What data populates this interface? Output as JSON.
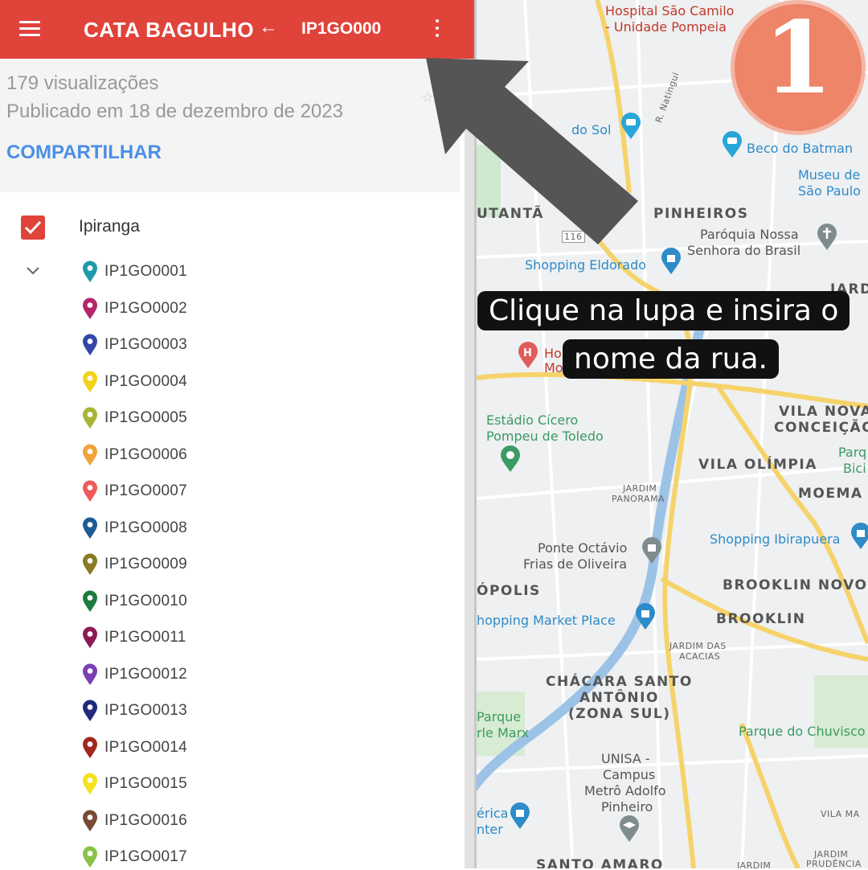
{
  "header": {
    "app_title": "CATA BAGULHO",
    "layer_title": "IP1GO000"
  },
  "info": {
    "views": "179 visualizações",
    "published": "Publicado em 18 de dezembro de 2023",
    "share_label": "COMPARTILHAR"
  },
  "layer": {
    "name": "Ipiranga",
    "checked": true,
    "items": [
      {
        "label": "IP1GO0001",
        "color": "#1f9aa8"
      },
      {
        "label": "IP1GO0002",
        "color": "#b3266b"
      },
      {
        "label": "IP1GO0003",
        "color": "#3547a8"
      },
      {
        "label": "IP1GO0004",
        "color": "#f2d21c"
      },
      {
        "label": "IP1GO0005",
        "color": "#a9b437"
      },
      {
        "label": "IP1GO0006",
        "color": "#f1a43a"
      },
      {
        "label": "IP1GO0007",
        "color": "#ef5a5a"
      },
      {
        "label": "IP1GO0008",
        "color": "#1e5b94"
      },
      {
        "label": "IP1GO0009",
        "color": "#8a7a22"
      },
      {
        "label": "IP1GO0010",
        "color": "#1e7a3e"
      },
      {
        "label": "IP1GO0011",
        "color": "#8c1a55"
      },
      {
        "label": "IP1GO0012",
        "color": "#7a3fb2"
      },
      {
        "label": "IP1GO0013",
        "color": "#1f2a7a"
      },
      {
        "label": "IP1GO0014",
        "color": "#a0281f"
      },
      {
        "label": "IP1GO0015",
        "color": "#f5e11c"
      },
      {
        "label": "IP1GO0016",
        "color": "#7a4a36"
      },
      {
        "label": "IP1GO0017",
        "color": "#8bc34a"
      }
    ]
  },
  "map": {
    "labels": {
      "hospital_1": "Hospital São Camilo",
      "hospital_2": "- Unidade Pompeia",
      "do_sol": "do Sol",
      "beco_batman": "Beco do Batman",
      "museu_1": "Museu de",
      "museu_2": "São Paulo",
      "utanta": "UTANTÃ",
      "pinheiros": "PINHEIROS",
      "paroquia_1": "Paróquia Nossa",
      "paroquia_2": "Senhora do Brasil",
      "shopping_eldorado": "Shopping Eldorado",
      "r_natingui": "R. Natingui",
      "jard": "JARD",
      "estadio_1": "Estádio Cícero",
      "estadio_2": "Pompeu de Toledo",
      "vila_nova_1": "VILA NOVA",
      "vila_nova_2": "CONCEIÇÃO",
      "parq_1": "Parq",
      "parq_2": "Bici",
      "vila_olimpia": "VILA OLÍMPIA",
      "moema": "MOEMA",
      "jardim_panorama_1": "JARDIM",
      "jardim_panorama_2": "PANORAMA",
      "shopping_ibirapuera": "Shopping Ibirapuera",
      "ponte_1": "Ponte Octávio",
      "ponte_2": "Frias de Oliveira",
      "brooklin_novo": "BROOKLIN NOVO",
      "opolis": "ÓPOLIS",
      "market_place": "hopping Market Place",
      "brooklin": "BROOKLIN",
      "jardim_acacias_1": "JARDIM DAS",
      "jardim_acacias_2": "ACACIAS",
      "chacara_1": "CHÁCARA SANTO",
      "chacara_2": "ANTÔNIO",
      "chacara_3": "(ZONA SUL)",
      "parque_marx_1": "Parque",
      "parque_marx_2": "rle Marx",
      "parque_chuvisco": "Parque do Chuvisco",
      "unisa_1": "UNISA -",
      "unisa_2": "Campus",
      "unisa_3": "Metrô Adolfo",
      "unisa_4": "Pinheiro",
      "rica_1": "érica",
      "rica_2": "nter",
      "vila_ma": "VILA MA",
      "jardim_prudencia_1": "JARDIM",
      "jardim_prudencia_2": "PRUDÊNCIA",
      "santo_amaro": "SANTO AMARO",
      "jardim_bottom": "JARDIM",
      "hosp_h": "Ho",
      "hosp_m": "Mo",
      "road_116": "116"
    }
  },
  "tooltip": {
    "line1": "Clique na lupa e insira o",
    "line2": "nome da rua."
  },
  "badge": {
    "number": "1"
  },
  "colors": {
    "brand": "#e0433a",
    "link": "#4a8fe6",
    "badge": "#ee8468"
  },
  "icons": [
    "menu-icon",
    "back-arrow-icon",
    "more-vert-icon",
    "star-icon",
    "checkbox-checked-icon",
    "chevron-down-icon",
    "map-pin-icon",
    "pointer-arrow-icon"
  ]
}
